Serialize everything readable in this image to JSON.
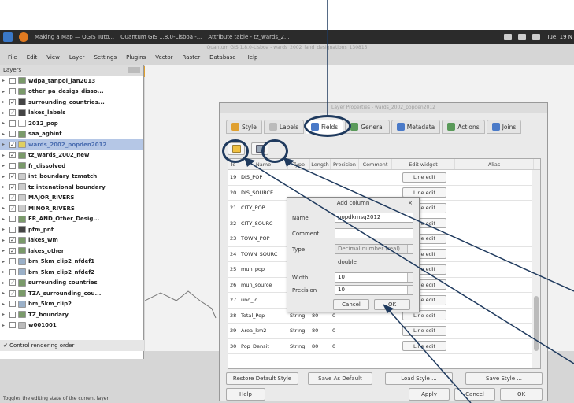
{
  "taskbar": {
    "items": [
      "Making a Map — QGIS Tuto...",
      "Quantum GIS 1.8.0-Lisboa -...",
      "Attribute table - tz_wards_2..."
    ],
    "clock": "Tue, 19 N"
  },
  "window": {
    "title": "Quantum GIS 1.8.0-Lisboa - wards_2002_land_designations_130815",
    "menu": [
      "File",
      "Edit",
      "View",
      "Layer",
      "Settings",
      "Plugins",
      "Vector",
      "Raster",
      "Database",
      "Help"
    ]
  },
  "layers_panel": {
    "title": "Layers",
    "items": [
      {
        "label": "wdpa_tanpol_jan2013",
        "checked": false,
        "color": "#7a9a6a"
      },
      {
        "label": "other_pa_desigs_disso...",
        "checked": false,
        "color": "#7a9a6a"
      },
      {
        "label": "surrounding_countries...",
        "checked": true,
        "color": "#444444"
      },
      {
        "label": "lakes_labels",
        "checked": true,
        "color": "#444444"
      },
      {
        "label": "2012_pop",
        "checked": false,
        "color": "#ffffff"
      },
      {
        "label": "saa_agbint",
        "checked": false,
        "color": "#7a9a6a"
      },
      {
        "label": "wards_2002_popden2012",
        "checked": true,
        "color": "#e0d060",
        "selected": true
      },
      {
        "label": "tz_wards_2002_new",
        "checked": true,
        "color": "#7a9a6a"
      },
      {
        "label": "fr_dissolved",
        "checked": false,
        "color": "#7a9a6a"
      },
      {
        "label": "int_boundary_tzmatch",
        "checked": true,
        "color": "#cccccc"
      },
      {
        "label": "tz intenational boundary",
        "checked": true,
        "color": "#cccccc"
      },
      {
        "label": "MAJOR_RIVERS",
        "checked": true,
        "color": "#cccccc"
      },
      {
        "label": "MINOR_RIVERS",
        "checked": true,
        "color": "#cccccc"
      },
      {
        "label": "FR_AND_Other_Desig...",
        "checked": false,
        "color": "#7a9a6a"
      },
      {
        "label": "pfm_pnt",
        "checked": false,
        "color": "#444444"
      },
      {
        "label": "lakes_wm",
        "checked": true,
        "color": "#7a9a6a"
      },
      {
        "label": "lakes_other",
        "checked": true,
        "color": "#7a9a6a"
      },
      {
        "label": "bm_5km_clip2_nfdef1",
        "checked": false,
        "color": "#9ab0c8"
      },
      {
        "label": "bm_5km_clip2_nfdef2",
        "checked": false,
        "color": "#9ab0c8"
      },
      {
        "label": "surrounding countries",
        "checked": true,
        "color": "#7a9a6a"
      },
      {
        "label": "TZA_surrounding_cou...",
        "checked": true,
        "color": "#7a9a6a"
      },
      {
        "label": "bm_5km_clip2",
        "checked": false,
        "color": "#9ab0c8"
      },
      {
        "label": "TZ_boundary",
        "checked": false,
        "color": "#7a9a6a"
      },
      {
        "label": "w001001",
        "checked": false,
        "color": "#bbbbbb"
      }
    ],
    "footer_checkbox": "Control rendering order",
    "footer_checkbox_checked": true
  },
  "statusbar": "Toggles the editing state of the current layer",
  "properties_dialog": {
    "title": "Layer Properties - wards_2002_popden2012",
    "tabs": [
      {
        "label": "Style",
        "active": false
      },
      {
        "label": "Labels",
        "active": false
      },
      {
        "label": "Fields",
        "active": true
      },
      {
        "label": "General",
        "active": false
      },
      {
        "label": "Metadata",
        "active": false
      },
      {
        "label": "Actions",
        "active": false
      },
      {
        "label": "Joins",
        "active": false
      }
    ],
    "columns": [
      "Id",
      "Name",
      "Type",
      "Length",
      "Precision",
      "Comment",
      "Edit widget",
      "Alias"
    ],
    "rows": [
      {
        "id": "19",
        "name": "DIS_POP",
        "type": "",
        "length": "",
        "precision": "",
        "edit": "Line edit"
      },
      {
        "id": "20",
        "name": "DIS_SOURCE",
        "type": "",
        "length": "",
        "precision": "",
        "edit": "Line edit"
      },
      {
        "id": "21",
        "name": "CITY_POP",
        "type": "",
        "length": "",
        "precision": "",
        "edit": "Line edit"
      },
      {
        "id": "22",
        "name": "CITY_SOURC",
        "type": "",
        "length": "",
        "precision": "",
        "edit": "Line edit"
      },
      {
        "id": "23",
        "name": "TOWN_POP",
        "type": "",
        "length": "",
        "precision": "",
        "edit": "Line edit"
      },
      {
        "id": "24",
        "name": "TOWN_SOURC",
        "type": "",
        "length": "",
        "precision": "",
        "edit": "Line edit"
      },
      {
        "id": "25",
        "name": "mun_pop",
        "type": "",
        "length": "",
        "precision": "",
        "edit": "Line edit"
      },
      {
        "id": "26",
        "name": "mun_source",
        "type": "",
        "length": "",
        "precision": "",
        "edit": "Line edit"
      },
      {
        "id": "27",
        "name": "unq_id",
        "type": "",
        "length": "",
        "precision": "",
        "edit": "Line edit"
      },
      {
        "id": "28",
        "name": "Total_Pop",
        "type": "String",
        "length": "80",
        "precision": "0",
        "edit": "Line edit"
      },
      {
        "id": "29",
        "name": "Area_km2",
        "type": "String",
        "length": "80",
        "precision": "0",
        "edit": "Line edit"
      },
      {
        "id": "30",
        "name": "Pop_Densit",
        "type": "String",
        "length": "80",
        "precision": "0",
        "edit": "Line edit"
      }
    ],
    "buttons": {
      "restore": "Restore Default Style",
      "save_default": "Save As Default",
      "load": "Load Style ...",
      "save_style": "Save Style ...",
      "help": "Help",
      "apply": "Apply",
      "cancel": "Cancel",
      "ok": "OK"
    }
  },
  "add_column_dialog": {
    "title": "Add column",
    "close": "×",
    "name_label": "Name",
    "name_value": "popdkmsq2012",
    "comment_label": "Comment",
    "comment_value": "",
    "type_label": "Type",
    "type_value": "Decimal number (real)",
    "type_sub": "double",
    "width_label": "Width",
    "width_value": "10",
    "precision_label": "Precision",
    "precision_value": "10",
    "cancel": "Cancel",
    "ok": "OK"
  },
  "colors": {
    "callout": "#1f3a5e",
    "selection": "#b5c7e6"
  }
}
